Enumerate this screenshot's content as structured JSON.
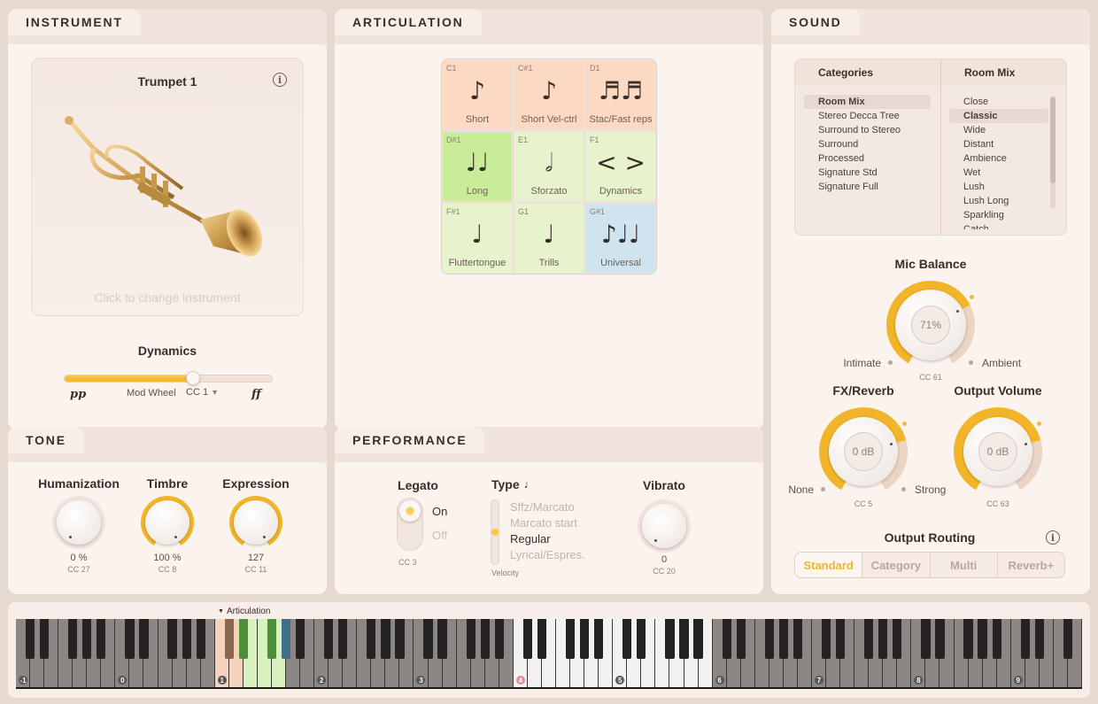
{
  "instrument": {
    "tab": "INSTRUMENT",
    "name": "Trumpet 1",
    "hint": "Click to change instrument",
    "dynamics": {
      "label": "Dynamics",
      "min_label": "pp",
      "max_label": "ff",
      "control_label": "Mod Wheel",
      "cc": "CC 1",
      "level_percent": 62
    }
  },
  "tone": {
    "tab": "TONE",
    "knobs": [
      {
        "label": "Humanization",
        "value": "0 %",
        "cc": "CC 27",
        "level": 0
      },
      {
        "label": "Timbre",
        "value": "100 %",
        "cc": "CC 8",
        "level": 1
      },
      {
        "label": "Expression",
        "value": "127",
        "cc": "CC 11",
        "level": 1
      }
    ]
  },
  "articulation": {
    "tab": "ARTICULATION",
    "cells": [
      {
        "key": "C1",
        "glyph": "♪",
        "name": "Short",
        "color": "#fcd9c2"
      },
      {
        "key": "C#1",
        "glyph": "♪",
        "name": "Short Vel-ctrl",
        "color": "#fcd9c2"
      },
      {
        "key": "D1",
        "glyph": "♬♬",
        "name": "Stac/Fast reps",
        "color": "#fcd9c2"
      },
      {
        "key": "D#1",
        "glyph": "♩♩",
        "name": "Long",
        "color": "#c9ec99"
      },
      {
        "key": "E1",
        "glyph": "𝅗𝅥",
        "name": "Sforzato",
        "color": "#e6f3cc"
      },
      {
        "key": "F1",
        "glyph": "< >",
        "name": "Dynamics",
        "color": "#e6f3cc"
      },
      {
        "key": "F#1",
        "glyph": "♩",
        "name": "Fluttertongue",
        "color": "#e6f3cc"
      },
      {
        "key": "G1",
        "glyph": "♩",
        "name": "Trills",
        "color": "#e6f3cc"
      },
      {
        "key": "G#1",
        "glyph": "♪♩♩",
        "name": "Universal",
        "color": "#cfe4ef"
      }
    ]
  },
  "performance": {
    "tab": "PERFORMANCE",
    "legato": {
      "label": "Legato",
      "on": "On",
      "off": "Off",
      "cc": "CC 3"
    },
    "type": {
      "label": "Type",
      "options": [
        "Sffz/Marcato",
        "Marcato start",
        "Regular",
        "Lyrical/Espres."
      ],
      "selected": "Regular",
      "sub": "Velocity"
    },
    "vibrato": {
      "label": "Vibrato",
      "value": "0",
      "cc": "CC 20",
      "level": 0
    }
  },
  "sound": {
    "tab": "SOUND",
    "categories_header": "Categories",
    "room_mix_header": "Room Mix",
    "categories": [
      "Room Mix",
      "Stereo Decca Tree",
      "Surround to Stereo",
      "Surround",
      "Processed",
      "Signature Std",
      "Signature Full"
    ],
    "categories_selected": "Room Mix",
    "room_mix": [
      "Close",
      "Classic",
      "Wide",
      "Distant",
      "Ambience",
      "Wet",
      "Lush",
      "Lush Long",
      "Sparkling",
      "Catch"
    ],
    "room_mix_selected": "Classic",
    "mic_balance": {
      "label": "Mic Balance",
      "value": "71%",
      "left": "Intimate",
      "right": "Ambient",
      "cc": "CC 61",
      "level": 0.71
    },
    "fx_reverb": {
      "label": "FX/Reverb",
      "value": "0 dB",
      "left": "None",
      "right": "Strong",
      "cc": "CC 5",
      "level": 0.75
    },
    "output_volume": {
      "label": "Output Volume",
      "value": "0 dB",
      "cc": "CC 63",
      "level": 0.75
    },
    "routing": {
      "label": "Output Routing",
      "options": [
        "Standard",
        "Category",
        "Multi",
        "Reverb+"
      ],
      "selected": "Standard"
    },
    "accent": "#f2b52a"
  },
  "keyboard": {
    "label": "Articulation",
    "octaves": [
      "-1",
      "0",
      "1",
      "2",
      "3",
      "4",
      "5",
      "6",
      "7",
      "8",
      "9"
    ]
  }
}
